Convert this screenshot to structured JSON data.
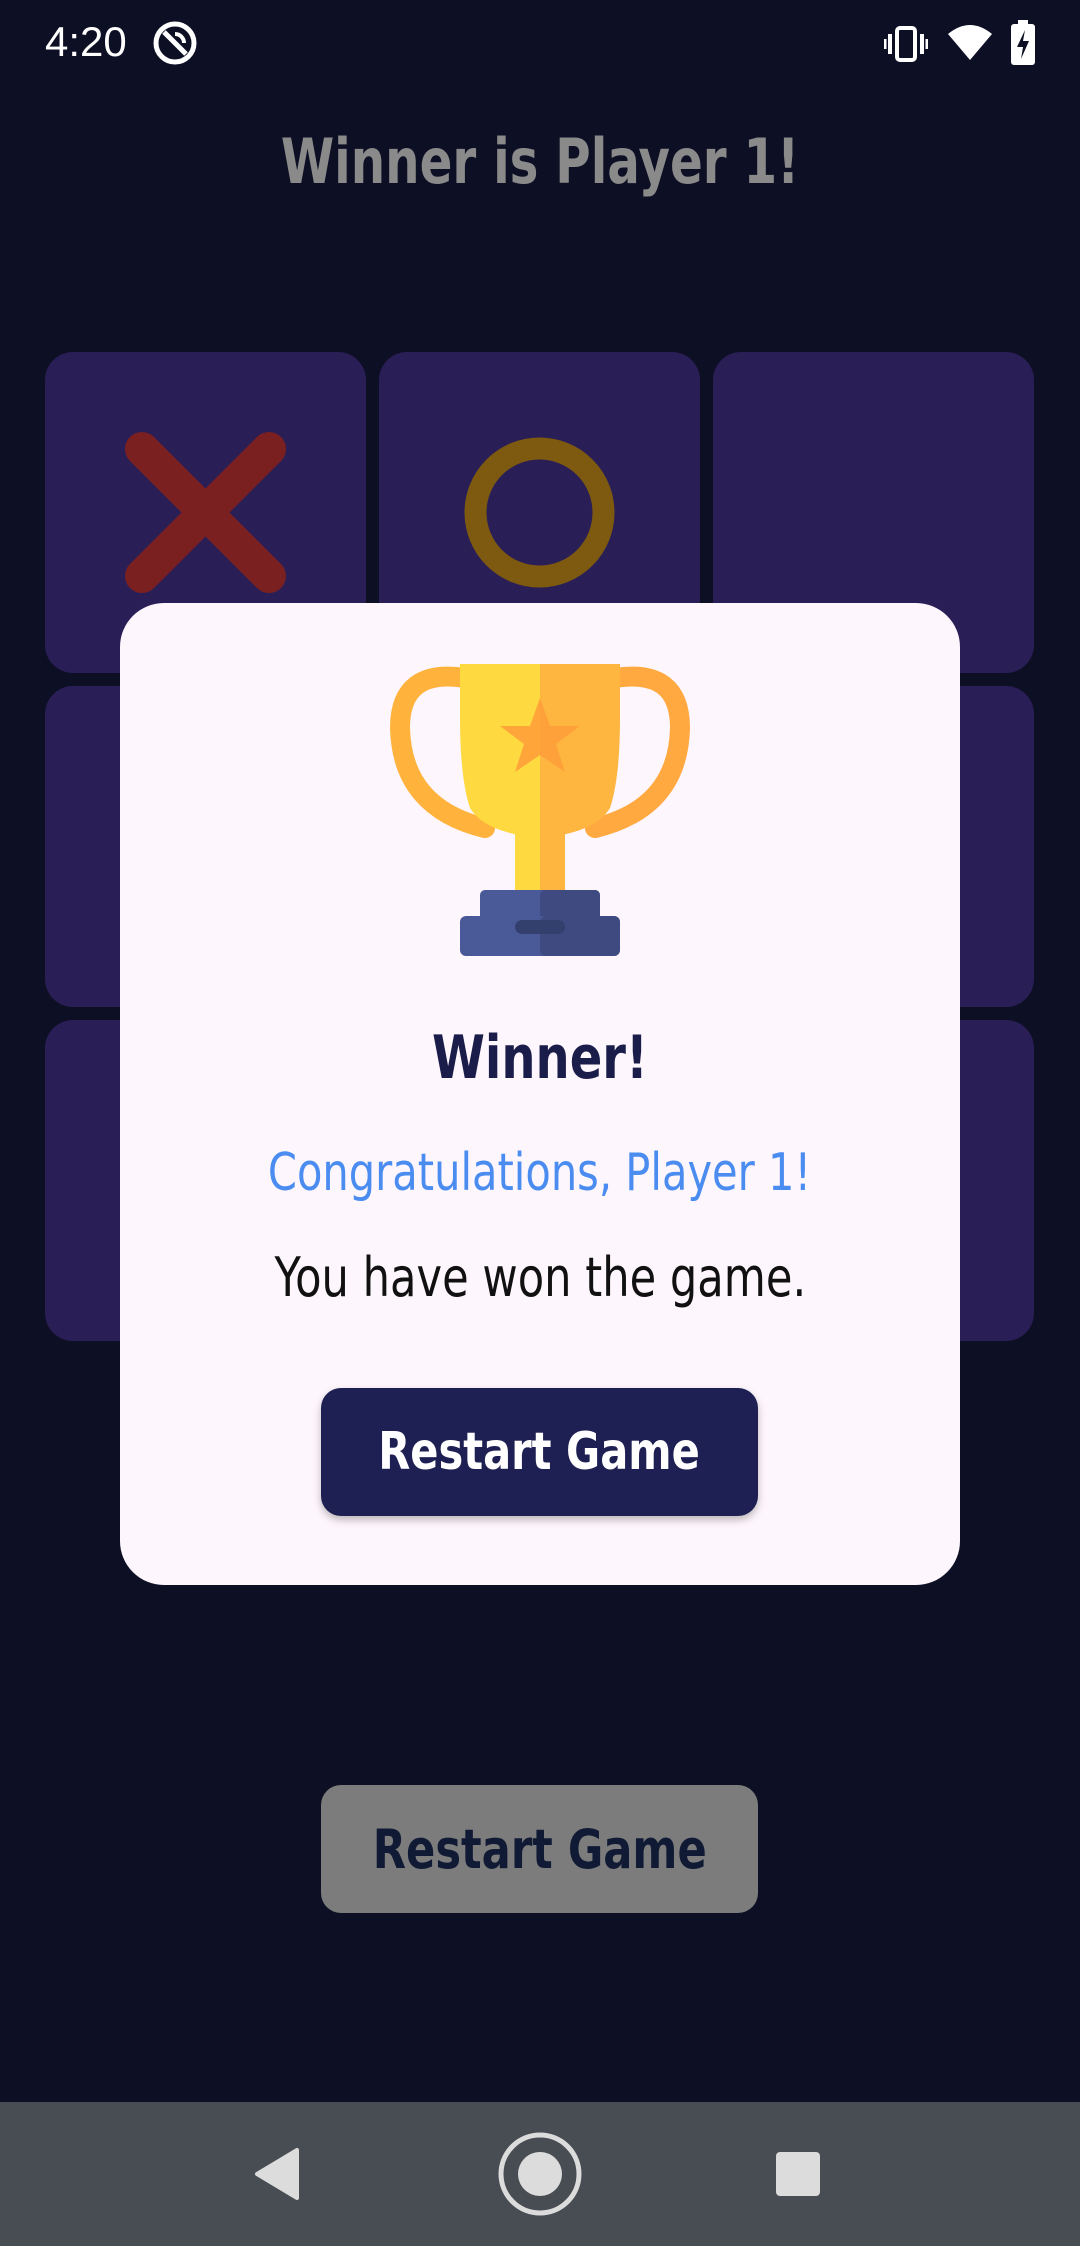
{
  "status_bar": {
    "time": "4:20",
    "icons": [
      "do-not-disturb-icon",
      "vibrate-icon",
      "wifi-icon",
      "battery-charging-icon"
    ]
  },
  "game": {
    "title": "Winner is Player 1!",
    "board": [
      "X",
      "O",
      "",
      "",
      "",
      "",
      "",
      "",
      ""
    ],
    "restart_label": "Restart Game",
    "colors": {
      "x": "#7a2020",
      "o": "#7d5a10",
      "cell": "#2a1e56",
      "background": "#0d0f24"
    }
  },
  "dialog": {
    "icon": "trophy-icon",
    "title": "Winner!",
    "subtitle": "Congratulations, Player 1!",
    "message": "You have won the game.",
    "button_label": "Restart Game",
    "colors": {
      "title": "#1a1c4a",
      "subtitle": "#4a8cf0",
      "button": "#1e1f52"
    }
  },
  "nav_bar": {
    "buttons": [
      "back-icon",
      "home-icon",
      "recents-icon"
    ]
  }
}
